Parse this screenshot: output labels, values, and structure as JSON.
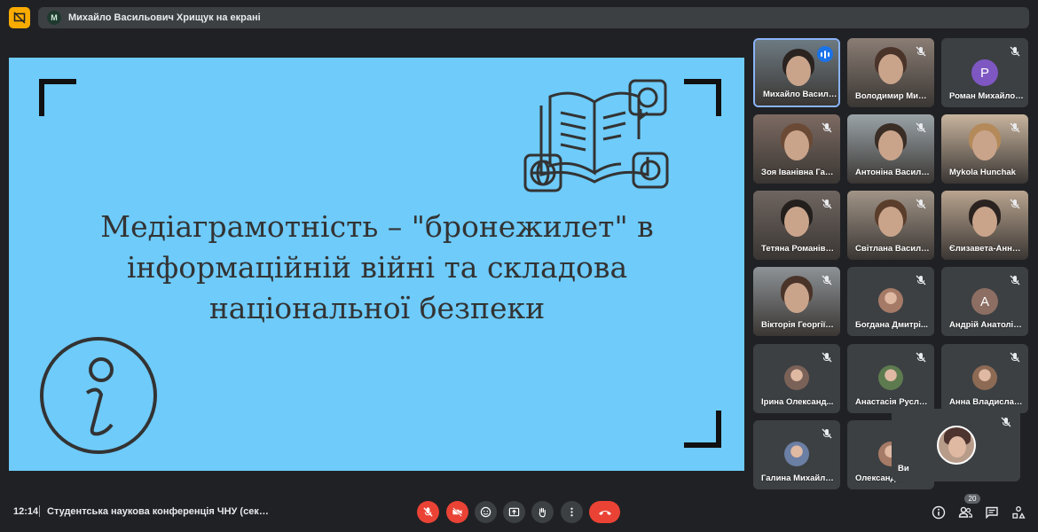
{
  "presenting": {
    "avatar_letter": "M",
    "text": "Михайло Васильович Хрищук на екрані"
  },
  "slide": {
    "title_lines": [
      "Медіаграмотність – \"бронежилет\" в",
      "інформаційній війні та складова",
      "національної безпеки"
    ],
    "background": "#6ecbfa"
  },
  "participants": [
    {
      "name": "Михайло Васильович Хрищук",
      "type": "video",
      "speaking": true
    },
    {
      "name": "Володимир Михайлович",
      "type": "video"
    },
    {
      "name": "Роман Михайлович",
      "type": "letter",
      "letter": "P",
      "color": "#7e57c2"
    },
    {
      "name": "Зоя Іванівна Гал...",
      "type": "video"
    },
    {
      "name": "Антоніна Василі...",
      "type": "video"
    },
    {
      "name": "Mykola Hunchak",
      "type": "video"
    },
    {
      "name": "Тетяна Романівн...",
      "type": "video"
    },
    {
      "name": "Світлана Василі...",
      "type": "video"
    },
    {
      "name": "Єлизавета-Анна...",
      "type": "video"
    },
    {
      "name": "Вікторія Георгіїв...",
      "type": "video"
    },
    {
      "name": "Богдана Дмитрі...",
      "type": "photo"
    },
    {
      "name": "Андрій Анатолій...",
      "type": "letter",
      "letter": "A",
      "color": "#8d6e63"
    },
    {
      "name": "Ірина Олександ...",
      "type": "photo"
    },
    {
      "name": "Анастасія Русла...",
      "type": "photo"
    },
    {
      "name": "Анна Владислав...",
      "type": "photo"
    },
    {
      "name": "Галина Михайлів...",
      "type": "photo"
    },
    {
      "name": "Олександ...",
      "type": "photo"
    }
  ],
  "self_view": {
    "label": "Ви"
  },
  "bottom": {
    "time": "12:14",
    "meeting_title": "Студентська наукова конференція ЧНУ (секційне засідання)",
    "participant_count": "20"
  },
  "controls": {
    "mic": "mic-off-icon",
    "camera": "camera-off-icon",
    "emoji": "emoji-icon",
    "present": "present-icon",
    "hand": "raise-hand-icon",
    "more": "more-icon",
    "end": "end-call-icon"
  },
  "colors": {
    "background": "#202124",
    "tile": "#3c4043",
    "accent_red": "#ea4335",
    "speaking_blue": "#1a73e8"
  }
}
